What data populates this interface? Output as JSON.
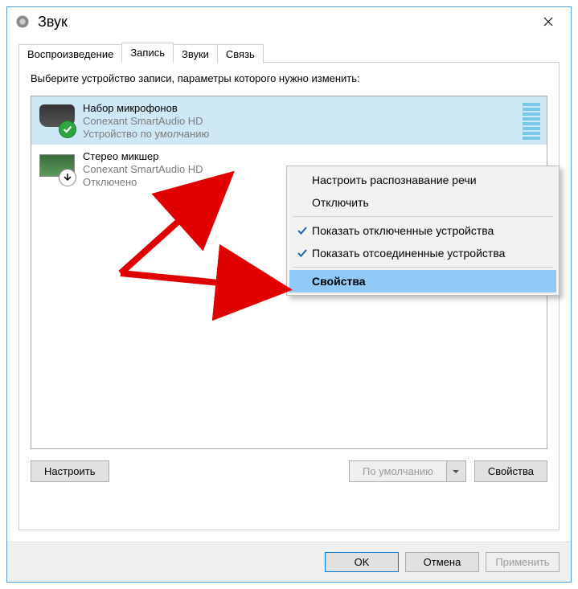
{
  "window": {
    "title": "Звук"
  },
  "tabs": [
    {
      "label": "Воспроизведение",
      "active": false
    },
    {
      "label": "Запись",
      "active": true
    },
    {
      "label": "Звуки",
      "active": false
    },
    {
      "label": "Связь",
      "active": false
    }
  ],
  "instruction": "Выберите устройство записи, параметры которого нужно изменить:",
  "devices": [
    {
      "name": "Набор микрофонов",
      "driver": "Conexant SmartAudio HD",
      "status": "Устройство по умолчанию",
      "selected": true,
      "badge": "default-check"
    },
    {
      "name": "Стерео микшер",
      "driver": "Conexant SmartAudio HD",
      "status": "Отключено",
      "selected": false,
      "badge": "disabled-down"
    }
  ],
  "panel_buttons": {
    "configure": "Настроить",
    "set_default": "По умолчанию",
    "properties": "Свойства"
  },
  "dialog_buttons": {
    "ok": "OK",
    "cancel": "Отмена",
    "apply": "Применить"
  },
  "context_menu": {
    "items": [
      {
        "label": "Настроить распознавание речи",
        "checked": false
      },
      {
        "label": "Отключить",
        "checked": false
      }
    ],
    "items2": [
      {
        "label": "Показать отключенные устройства",
        "checked": true
      },
      {
        "label": "Показать отсоединенные устройства",
        "checked": true
      }
    ],
    "items3": [
      {
        "label": "Свойства",
        "checked": false,
        "highlight": true
      }
    ]
  }
}
